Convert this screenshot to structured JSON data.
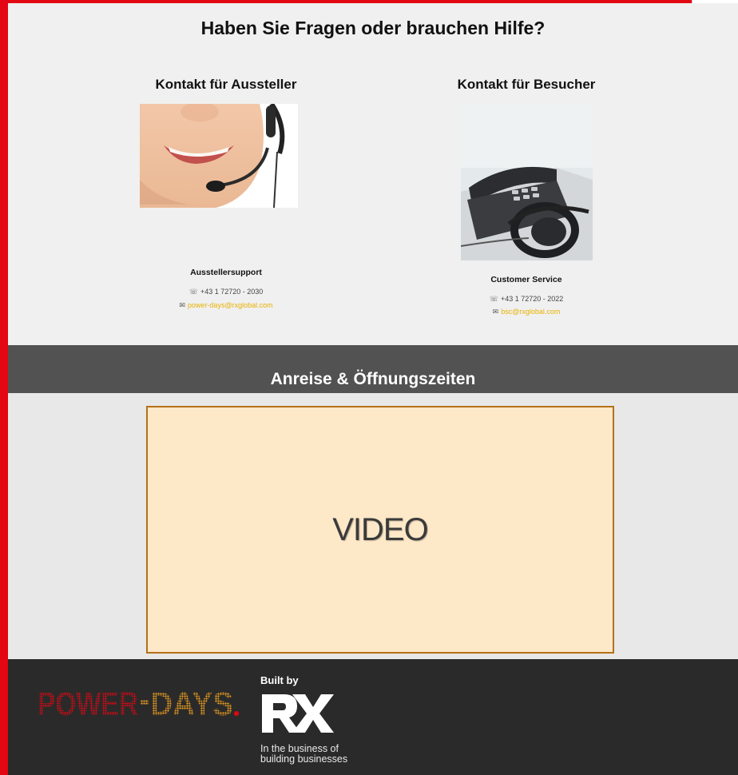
{
  "contact": {
    "title": "Haben Sie Fragen oder brauchen Hilfe?",
    "exhibitor": {
      "heading": "Kontakt für Aussteller",
      "name": "Ausstellersupport",
      "phone": "+43 1 72720 - 2030",
      "email": "power-days@rxglobal.com"
    },
    "visitor": {
      "heading": "Kontakt für Besucher",
      "name": "Customer Service",
      "phone": "+43 1 72720 - 2022",
      "email": "bsc@rxglobal.com"
    }
  },
  "hours": {
    "title": "Anreise & Öffnungszeiten"
  },
  "video": {
    "label": "VIDEO"
  },
  "footer": {
    "brand_logo": "POWER-DAYS",
    "built_by": "Built by",
    "rx_logo": "RX",
    "rx_tagline_1": "In the business of",
    "rx_tagline_2": "building businesses"
  },
  "icons": {
    "phone": "phone-icon",
    "mail": "mail-icon"
  },
  "colors": {
    "accent": "#e30613",
    "email": "#e8b300",
    "band": "#525252",
    "footer": "#2a2a2a",
    "video_bg": "#fde8c8",
    "video_border": "#b5701a",
    "logo_orange": "#f0a020"
  }
}
